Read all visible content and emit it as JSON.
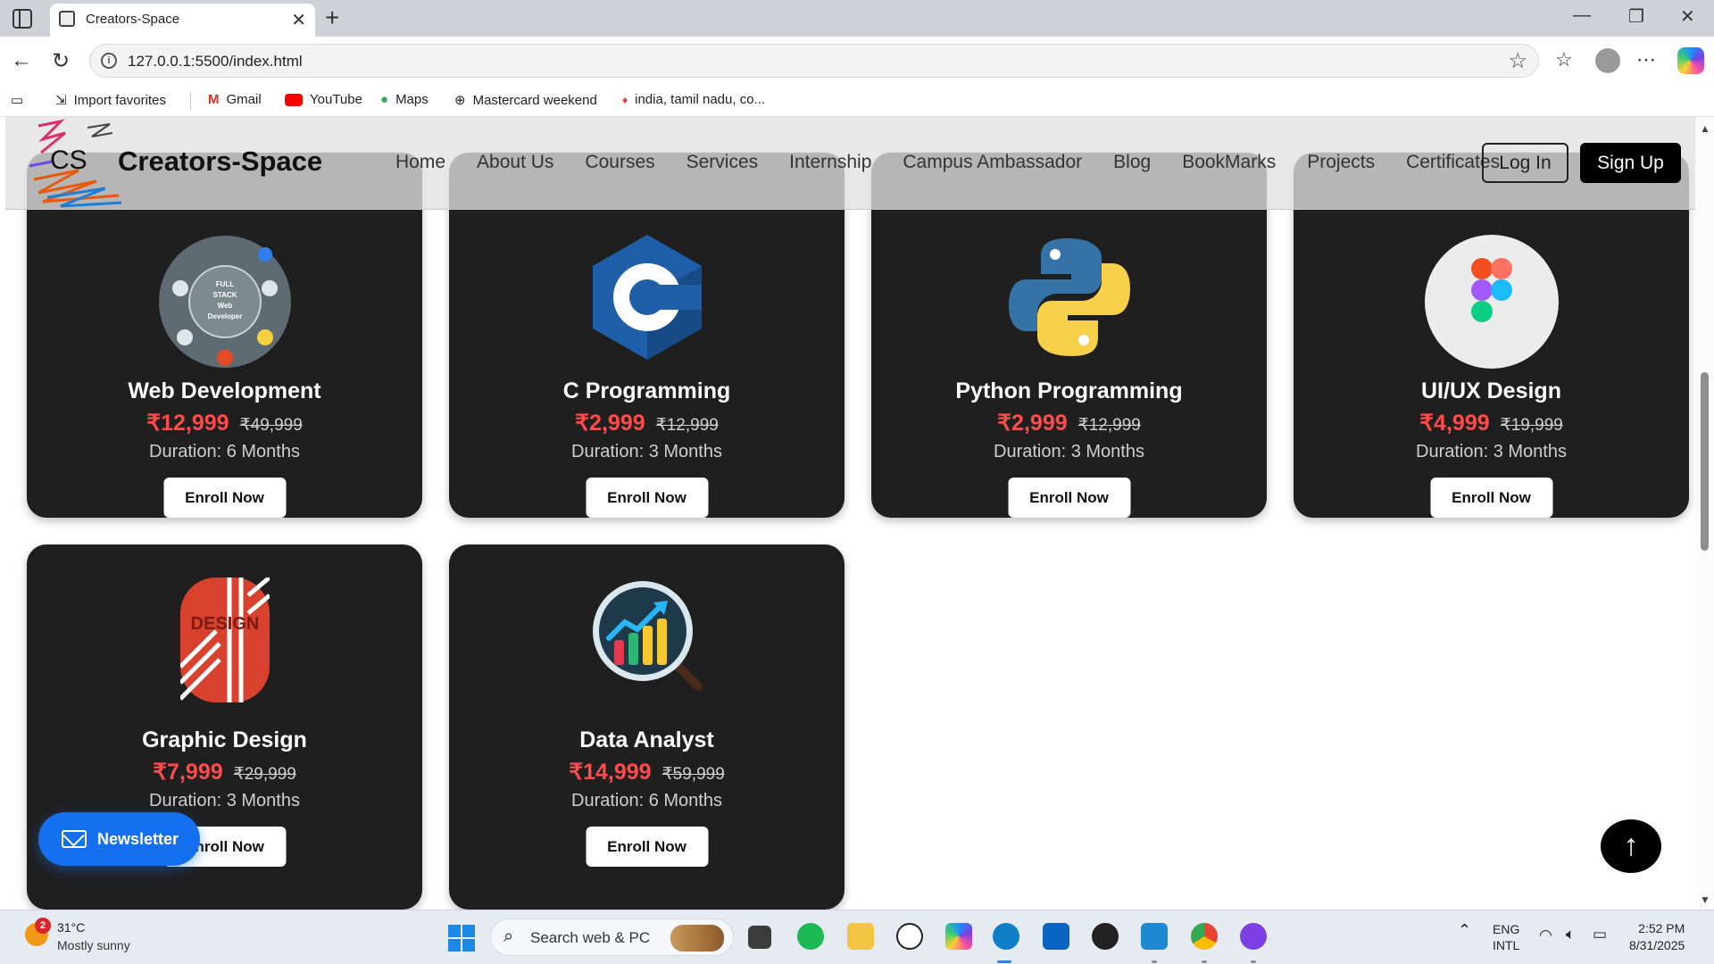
{
  "browser": {
    "tab_title": "Creators-Space",
    "url": "127.0.0.1:5500/index.html",
    "favorites": [
      {
        "label": "Import favorites"
      },
      {
        "label": "Gmail"
      },
      {
        "label": "YouTube"
      },
      {
        "label": "Maps"
      },
      {
        "label": "Mastercard weekend"
      },
      {
        "label": "india, tamil nadu, co..."
      }
    ]
  },
  "site": {
    "logo_short": "CS",
    "logo_text": "Creators-Space",
    "nav": [
      "Home",
      "About Us",
      "Courses",
      "Services",
      "Internship",
      "Campus Ambassador",
      "Blog",
      "BookMarks",
      "Projects",
      "Certificates"
    ],
    "login_label": "Log In",
    "signup_label": "Sign Up",
    "icon_text_web": [
      "FULL",
      "STACK",
      "Web",
      "Developer"
    ],
    "icon_text_graphic": "DESIGN"
  },
  "courses": [
    {
      "title": "Web Development",
      "price": "₹12,999",
      "old_price": "₹49,999",
      "duration": "Duration: 6 Months",
      "cta": "Enroll Now",
      "icon": "web-dev-icon"
    },
    {
      "title": "C Programming",
      "price": "₹2,999",
      "old_price": "₹12,999",
      "duration": "Duration: 3 Months",
      "cta": "Enroll Now",
      "icon": "c-lang-icon"
    },
    {
      "title": "Python Programming",
      "price": "₹2,999",
      "old_price": "₹12,999",
      "duration": "Duration: 3 Months",
      "cta": "Enroll Now",
      "icon": "python-icon"
    },
    {
      "title": "UI/UX Design",
      "price": "₹4,999",
      "old_price": "₹19,999",
      "duration": "Duration: 3 Months",
      "cta": "Enroll Now",
      "icon": "figma-icon"
    },
    {
      "title": "Graphic Design",
      "price": "₹7,999",
      "old_price": "₹29,999",
      "duration": "Duration: 3 Months",
      "cta": "Enroll Now",
      "icon": "graphic-design-icon"
    },
    {
      "title": "Data Analyst",
      "price": "₹14,999",
      "old_price": "₹59,999",
      "duration": "Duration: 6 Months",
      "cta": "Enroll Now",
      "icon": "data-analyst-icon"
    }
  ],
  "newsletter_label": "Newsletter",
  "taskbar": {
    "weather_badge": "2",
    "weather_temp": "31°C",
    "weather_desc": "Mostly sunny",
    "search_placeholder": "Search web & PC",
    "lang_1": "ENG",
    "lang_2": "INTL",
    "time": "2:52 PM",
    "date": "8/31/2025"
  },
  "colors": {
    "card_bg": "#1f1f1f",
    "price_red": "#ff4b4b",
    "newsletter_blue": "#1570ef"
  }
}
